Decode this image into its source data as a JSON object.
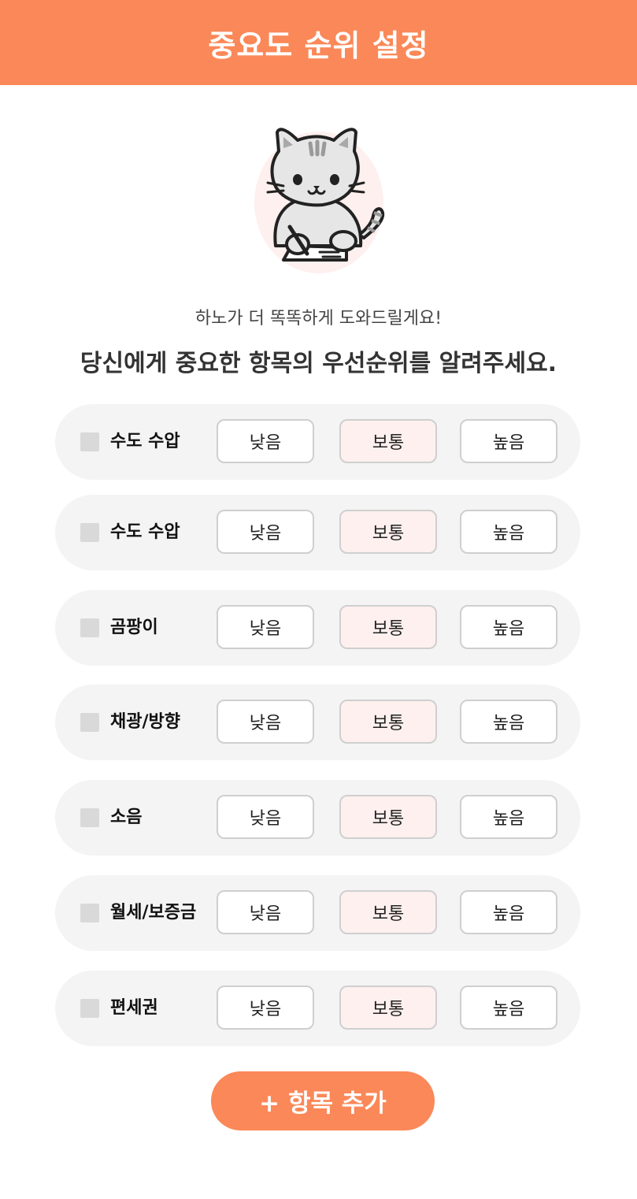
{
  "header": {
    "title": "중요도 순위 설정"
  },
  "intro": {
    "subtitle": "하노가 더 똑똑하게 도와드릴게요!",
    "headline": "당신에게 중요한 항목의 우선순위를 알려주세요."
  },
  "options": {
    "low": "낮음",
    "mid": "보통",
    "high": "높음"
  },
  "items": [
    {
      "label": "수도 수압",
      "checked": false,
      "selected": "보통"
    },
    {
      "label": "수도 수압",
      "checked": false,
      "selected": "보통"
    },
    {
      "label": "곰팡이",
      "checked": false,
      "selected": "보통"
    },
    {
      "label": "채광/방향",
      "checked": false,
      "selected": "보통"
    },
    {
      "label": "소음",
      "checked": false,
      "selected": "보통"
    },
    {
      "label": "월세/보증금",
      "checked": false,
      "selected": "보통"
    },
    {
      "label": "편세권",
      "checked": false,
      "selected": "보통"
    }
  ],
  "add_button": {
    "label": "+ 항목 추가"
  },
  "colors": {
    "accent": "#fb8858",
    "row_background": "#f4f4f4",
    "selected_option_background": "#fdf0ee",
    "checkbox": "#d9d9d9"
  }
}
